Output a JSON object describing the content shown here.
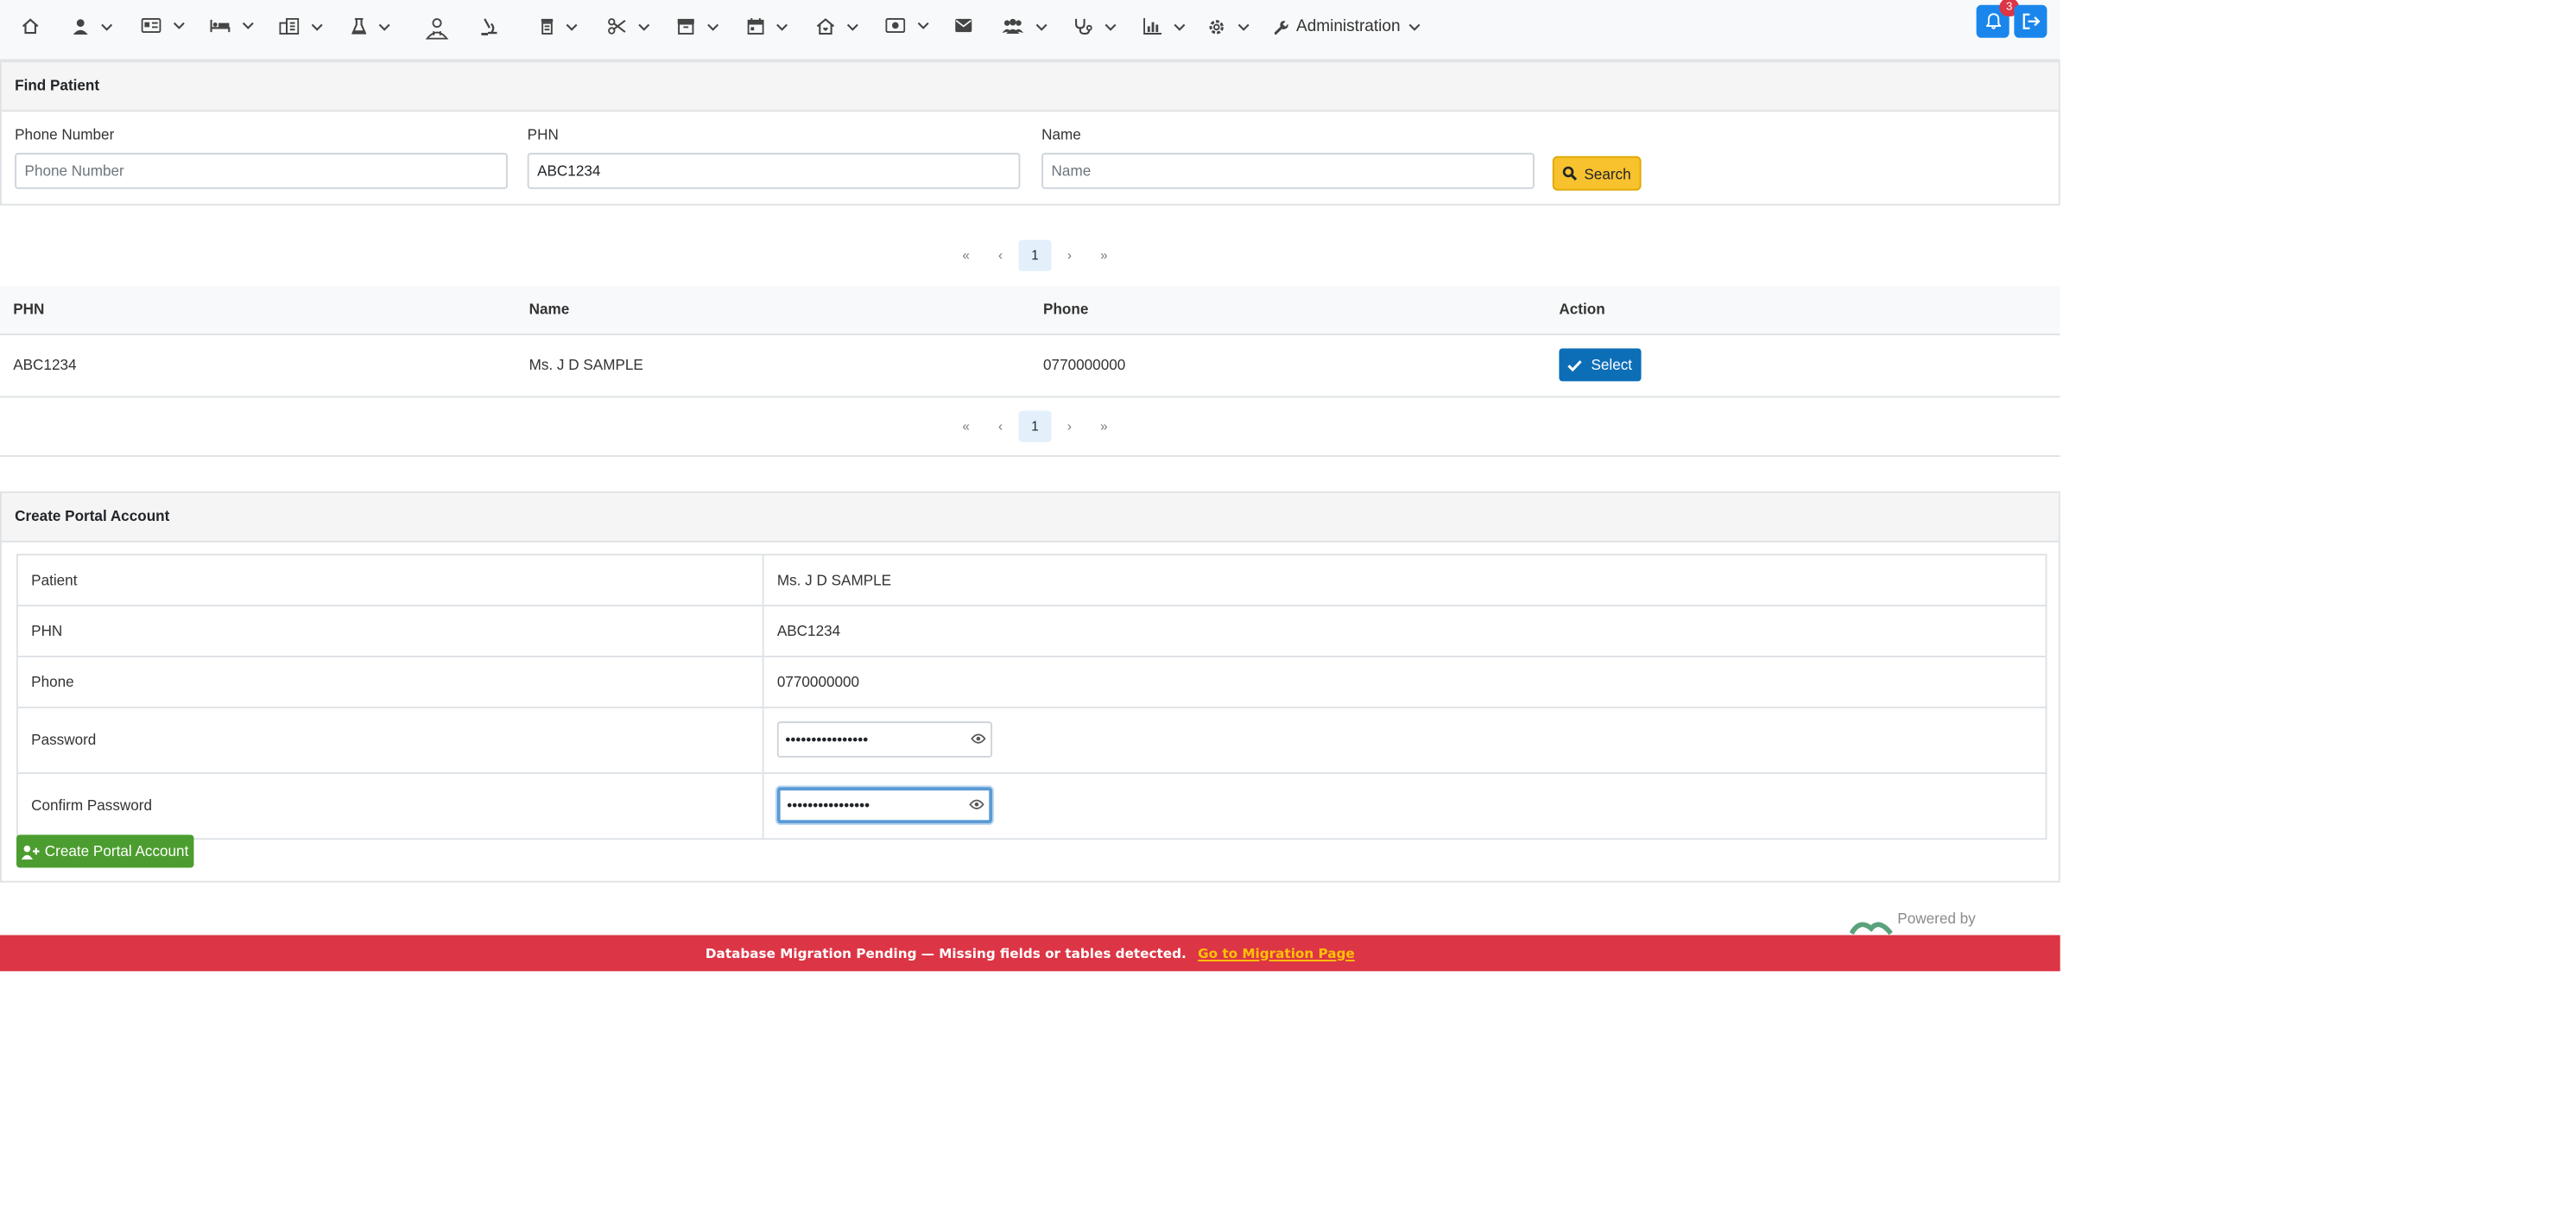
{
  "navbar": {
    "icons": [
      "home-icon",
      "user-icon",
      "id-card-icon",
      "bed-icon",
      "building-icon",
      "flask-icon",
      "doctor-icon",
      "microscope-icon",
      "prescription-bottle-icon",
      "scissors-icon",
      "archive-icon",
      "calendar-icon",
      "home-care-icon",
      "money-icon",
      "envelope-icon",
      "users-icon",
      "stethoscope-icon",
      "chart-icon",
      "gear-icon",
      "wrench-icon"
    ],
    "admin_label": "Administration",
    "notification_count": "3"
  },
  "find_patient": {
    "title": "Find Patient",
    "phone_label": "Phone Number",
    "phone_placeholder": "Phone Number",
    "phone_value": "",
    "phn_label": "PHN",
    "phn_value": "ABC1234",
    "name_label": "Name",
    "name_placeholder": "Name",
    "name_value": "",
    "search_label": "Search"
  },
  "paginator": {
    "current_page": "1"
  },
  "results": {
    "headers": [
      "PHN",
      "Name",
      "Phone",
      "Action"
    ],
    "rows": [
      {
        "phn": "ABC1234",
        "name": "Ms. J D SAMPLE",
        "phone": "0770000000",
        "action": "Select"
      }
    ]
  },
  "portal": {
    "title": "Create Portal Account",
    "patient_label": "Patient",
    "patient_value": "Ms. J D SAMPLE",
    "phn_label": "PHN",
    "phn_value": "ABC1234",
    "phone_label": "Phone",
    "phone_value": "0770000000",
    "password_label": "Password",
    "password_mask": "••••••••••••••••",
    "confirm_label": "Confirm Password",
    "confirm_mask": "••••••••••••••••",
    "create_label": "Create Portal Account"
  },
  "footer": {
    "powered_by": "Powered by"
  },
  "banner": {
    "message": "Database Migration Pending — Missing fields or tables detected.",
    "link": "Go to Migration Page"
  },
  "colors": {
    "primary": "#1a86ec",
    "select_button": "#0d6eb8",
    "search_button": "#f8c22e",
    "create_button": "#4c9d2f",
    "banner": "#dc3545",
    "banner_link": "#ffc107"
  }
}
